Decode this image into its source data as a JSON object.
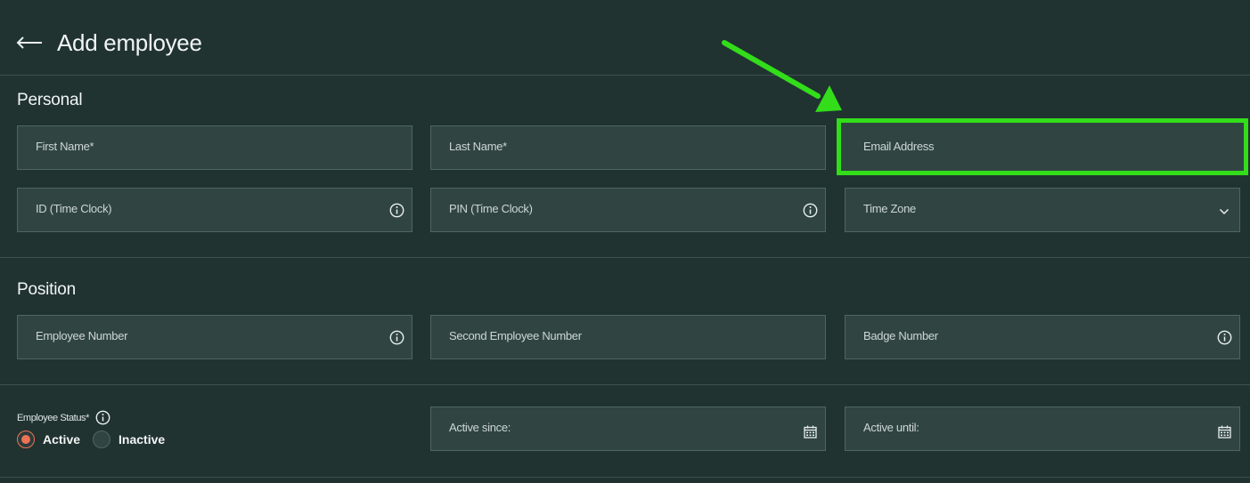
{
  "header": {
    "title": "Add employee"
  },
  "sections": {
    "personal": "Personal",
    "position": "Position"
  },
  "fields": {
    "first_name": "First Name*",
    "last_name": "Last Name*",
    "email": "Email Address",
    "id_time_clock": "ID (Time Clock)",
    "pin_time_clock": "PIN (Time Clock)",
    "time_zone": "Time Zone",
    "employee_number": "Employee Number",
    "second_employee_number": "Second Employee Number",
    "badge_number": "Badge Number",
    "active_since": "Active since:",
    "active_until": "Active until:"
  },
  "status": {
    "label": "Employee Status*",
    "options": [
      "Active",
      "Inactive"
    ],
    "selected": "Active"
  },
  "colors": {
    "background": "#203331",
    "field": "#304542",
    "accent_radio": "#ee7255",
    "annotation_green": "#33dd1a"
  },
  "icons": {
    "back": "arrow-left-icon",
    "info": "info-circle-icon",
    "dropdown": "chevron-down-icon",
    "calendar": "calendar-icon"
  }
}
